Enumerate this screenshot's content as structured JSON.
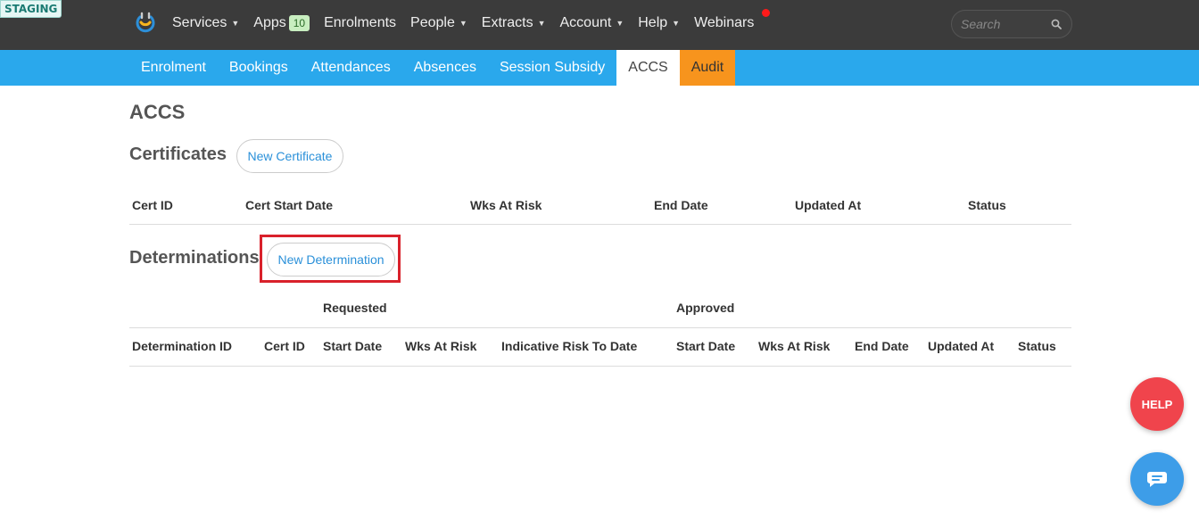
{
  "env_badge": "STAGING",
  "topnav": {
    "items": [
      {
        "label": "Services",
        "dropdown": true
      },
      {
        "label": "Apps",
        "badge": "10"
      },
      {
        "label": "Enrolments"
      },
      {
        "label": "People",
        "dropdown": true
      },
      {
        "label": "Extracts",
        "dropdown": true
      },
      {
        "label": "Account",
        "dropdown": true
      },
      {
        "label": "Help",
        "dropdown": true
      },
      {
        "label": "Webinars"
      }
    ],
    "search_placeholder": "Search"
  },
  "subnav": {
    "tabs": [
      {
        "label": "Enrolment"
      },
      {
        "label": "Bookings"
      },
      {
        "label": "Attendances"
      },
      {
        "label": "Absences"
      },
      {
        "label": "Session Subsidy"
      },
      {
        "label": "ACCS",
        "active": true
      },
      {
        "label": "Audit"
      }
    ]
  },
  "page": {
    "title": "ACCS",
    "certificates": {
      "title": "Certificates",
      "new_button": "New Certificate",
      "columns": [
        "Cert ID",
        "Cert Start Date",
        "Wks At Risk",
        "End Date",
        "Updated At",
        "Status"
      ]
    },
    "determinations": {
      "title": "Determinations",
      "new_button": "New Determination",
      "group_headers": [
        "Requested",
        "Approved"
      ],
      "columns": [
        "Determination ID",
        "Cert ID",
        "Start Date",
        "Wks At Risk",
        "Indicative Risk To Date",
        "Start Date",
        "Wks At Risk",
        "End Date",
        "Updated At",
        "Status"
      ]
    }
  },
  "help_button": "HELP",
  "colors": {
    "topnav_bg": "#3b3b3b",
    "subnav_bg": "#2aa8ec",
    "audit_tab": "#f7941d",
    "link_blue": "#2a90d9",
    "highlight_red": "#d9212b",
    "help_red": "#f0444c",
    "chat_blue": "#3d9de8"
  }
}
